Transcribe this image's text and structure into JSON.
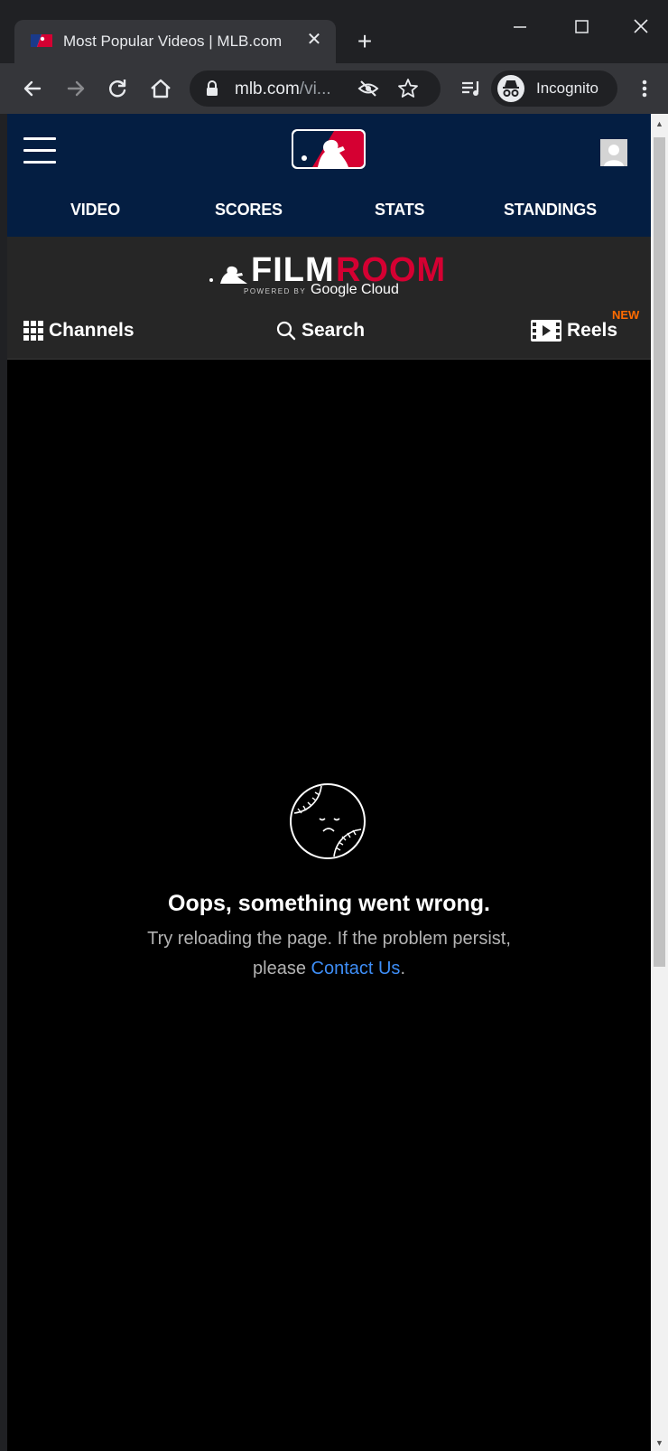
{
  "browser": {
    "tab_title": "Most Popular Videos | MLB.com",
    "tab_close": "✕",
    "new_tab": "+",
    "url_host": "mlb.com",
    "url_rest": "/vi...",
    "incognito_label": "Incognito"
  },
  "header": {
    "nav": [
      "VIDEO",
      "SCORES",
      "STATS",
      "STANDINGS"
    ]
  },
  "filmroom": {
    "film": "FILM",
    "room": "ROOM",
    "powered": "POWERED BY",
    "cloud": "Google Cloud",
    "channels_label": "Channels",
    "search_label": "Search",
    "reels_label": "Reels",
    "reels_badge": "NEW"
  },
  "error": {
    "title": "Oops, something went wrong.",
    "line1": "Try reloading the page. If the problem persist,",
    "line2_prefix": "please ",
    "link_label": "Contact Us",
    "line2_suffix": "."
  },
  "colors": {
    "mlb_navy": "#041e42",
    "filmroom_red": "#d50032",
    "link_blue": "#3e8ef7",
    "new_badge_orange": "#ff6b00"
  }
}
